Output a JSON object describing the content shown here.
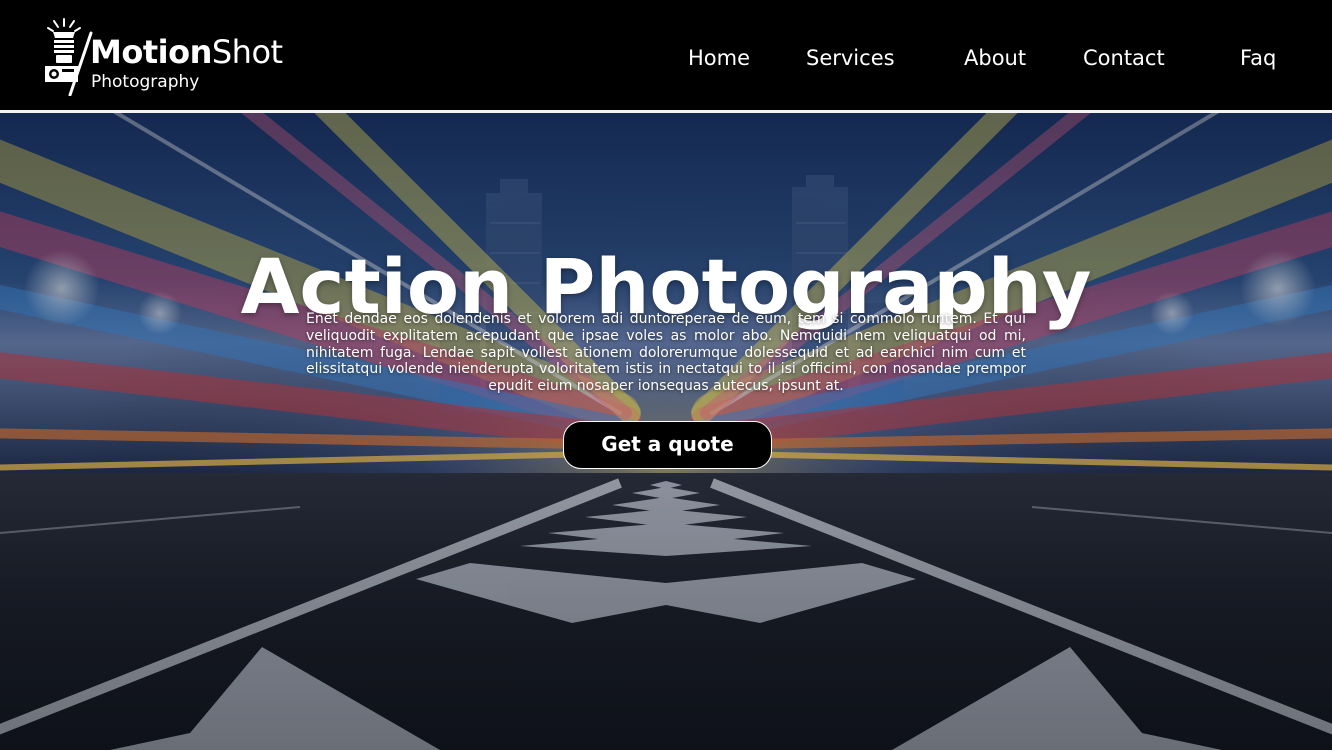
{
  "brand": {
    "name_bold": "Motion",
    "name_light": "Shot",
    "tagline": "Photography"
  },
  "nav": {
    "items": [
      {
        "label": "Home"
      },
      {
        "label": "Services"
      },
      {
        "label": "About"
      },
      {
        "label": "Contact"
      },
      {
        "label": "Faq"
      }
    ]
  },
  "hero": {
    "title": "Action Photography",
    "body": "Enet dendae eos dolendenis et volorem adi duntoreperae de eum, tem si commolo runtem. Et qui veliquodit explitatem acepudant que ipsae voles as molor abo. Nemquidi nem veliquatqui od mi, nihitatem fuga. Lendae sapit vollest ationem dolorerumque dolessequid et ad earchici nim cum et elissitatqui volende nienderupta voloritatem istis in nectatqui to il isi officimi, con nosandae prempor epudit eium nosaper ionsequas autecus, ipsunt at.",
    "cta_label": "Get a quote",
    "background": "city-highway-light-trails-photo"
  },
  "icons": {
    "logo": "camera-flash-icon"
  },
  "colors": {
    "header_bg": "#000000",
    "text": "#ffffff",
    "button_bg": "#000000"
  }
}
